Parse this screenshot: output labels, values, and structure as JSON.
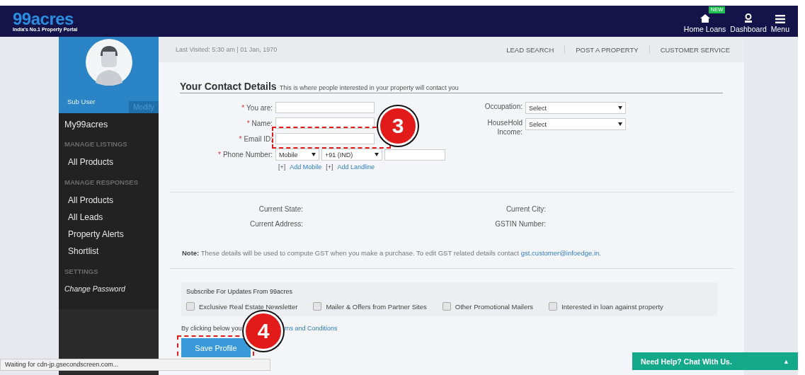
{
  "header": {
    "logo": "99acres",
    "tagline": "India's No.1 Property Portal",
    "nav": [
      {
        "kind": "home",
        "label": "Home Loans",
        "badge": "NEW"
      },
      {
        "kind": "user",
        "label": "Dashboard"
      },
      {
        "kind": "menu",
        "label": "Menu"
      }
    ]
  },
  "sidebar": {
    "user": "Sub User",
    "modify": "Modify",
    "items": [
      {
        "kind": "top",
        "label": "My99acres"
      },
      {
        "kind": "heading",
        "label": "MANAGE LISTINGS"
      },
      {
        "kind": "item",
        "label": "All Products"
      },
      {
        "kind": "heading",
        "label": "MANAGE RESPONSES"
      },
      {
        "kind": "item",
        "label": "All Products"
      },
      {
        "kind": "item",
        "label": "All Leads"
      },
      {
        "kind": "item",
        "label": "Property Alerts"
      },
      {
        "kind": "item",
        "label": "Shortlist"
      },
      {
        "kind": "heading",
        "label": "SETTINGS"
      },
      {
        "kind": "italic",
        "label": "Change Password"
      }
    ]
  },
  "topbar": {
    "last_visited": "Last Visited: 5:30 am | 01 Jan, 1970",
    "links": [
      "LEAD SEARCH",
      "POST A PROPERTY",
      "CUSTOMER SERVICE"
    ]
  },
  "contact": {
    "title": "Your Contact Details",
    "subtitle": "This is where people interested in your property will contact you",
    "left_fields": [
      {
        "kind": "text",
        "marker": "*",
        "label": "You are:"
      },
      {
        "kind": "text",
        "marker": "*",
        "label": "Name:"
      },
      {
        "kind": "text",
        "marker": "*",
        "label": "Email ID:"
      },
      {
        "kind": "phone",
        "marker": "*",
        "label": "Phone Number:",
        "type_select": "Mobile",
        "code_select": "+91 (IND)"
      }
    ],
    "add_links": [
      {
        "prefix": "[+]",
        "label": "Add Mobile"
      },
      {
        "prefix": "[+]",
        "label": "Add Landline"
      }
    ],
    "right_fields": [
      {
        "label": "Occupation:",
        "value": "Select"
      },
      {
        "label": "HouseHold Income:",
        "value": "Select"
      }
    ]
  },
  "gst": {
    "fields": [
      {
        "label": "Current State:"
      },
      {
        "label": "Current City:"
      },
      {
        "label": "Current Address:"
      },
      {
        "label": "GSTIN Number:"
      }
    ],
    "note": "**Note:** These details will be used to compute GST when you make a purchase. To edit GST related details contact",
    "email": "gst.customer@infoedge.in."
  },
  "subscribe": {
    "title": "Subscribe For Updates From 99acres",
    "options": [
      {
        "label": "Exclusive Real Estate Newsletter",
        "checked": false
      },
      {
        "label": "Mailer & Offers from Partner Sites",
        "checked": false
      },
      {
        "label": "Other Promotional Mailers",
        "checked": false
      },
      {
        "label": "Interested in loan against property",
        "checked": false
      }
    ]
  },
  "terms": {
    "text": "By clicking below you",
    "link": "ms and Conditions"
  },
  "save_button": "Save Profile",
  "annotations": [
    "3",
    "4"
  ],
  "status_bar": "Waiting for cdn-jp.gsecondscreen.com...",
  "chat": {
    "label": "Need Help? Chat With Us.",
    "arrow": "▲"
  }
}
